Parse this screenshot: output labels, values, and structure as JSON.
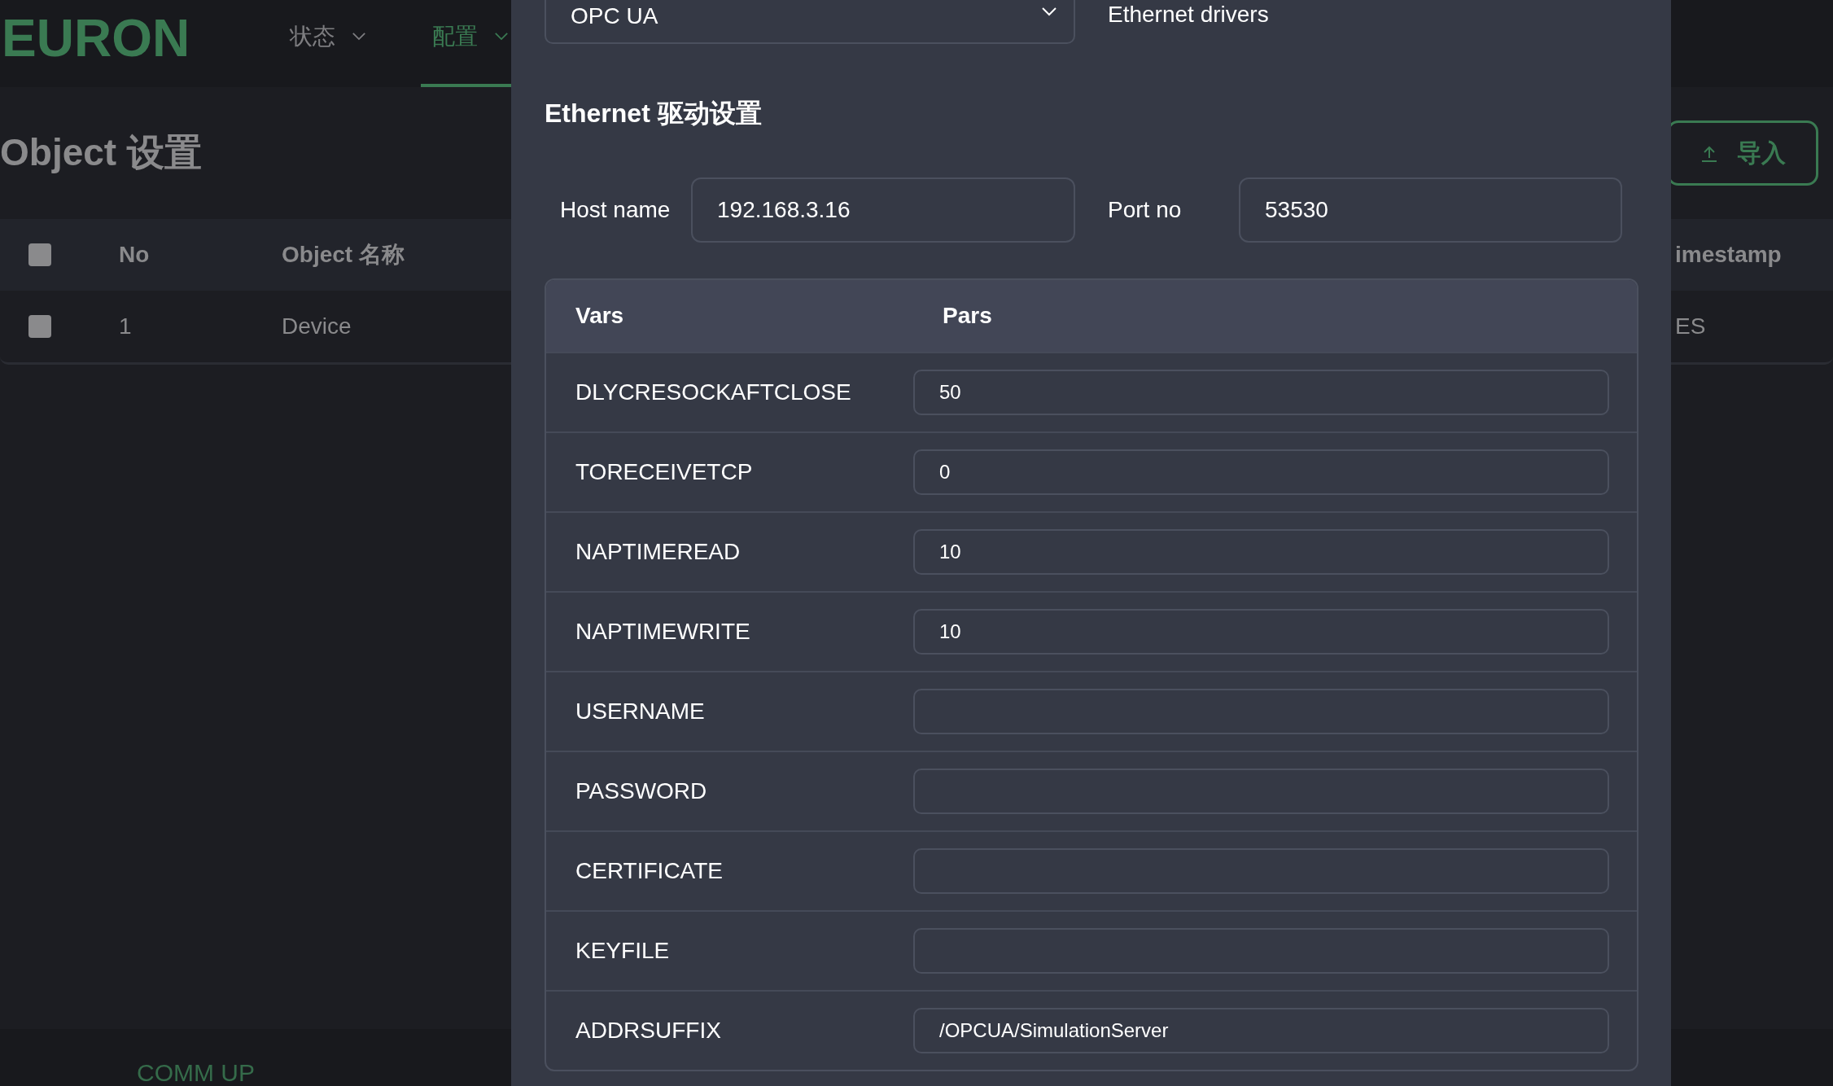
{
  "app": {
    "logo": "EURON",
    "nav": [
      {
        "label": "状态",
        "selected": false
      },
      {
        "label": "配置",
        "selected": true
      }
    ]
  },
  "page": {
    "title": "Object 设置",
    "import_button": "导入",
    "header_checked": false,
    "table": {
      "columns": [
        "No",
        "Object 名称",
        "imestamp"
      ],
      "rows": [
        {
          "checked": false,
          "cells": [
            "1",
            "Device",
            "ES"
          ]
        }
      ]
    }
  },
  "status": "COMM UP",
  "drawer": {
    "driver_select": "OPC UA",
    "driver_description": "Ethernet drivers",
    "section_title": "Ethernet 驱动设置",
    "fields": [
      {
        "label": "Host name",
        "value": "192.168.3.16"
      },
      {
        "label": "Port no",
        "value": "53530"
      }
    ],
    "params_table": {
      "columns": [
        "Vars",
        "Pars"
      ],
      "rows": [
        {
          "var": "DLYCRESOCKAFTCLOSE",
          "value": "50"
        },
        {
          "var": "TORECEIVETCP",
          "value": "0"
        },
        {
          "var": "NAPTIMEREAD",
          "value": "10"
        },
        {
          "var": "NAPTIMEWRITE",
          "value": "10"
        },
        {
          "var": "USERNAME"
        },
        {
          "var": "PASSWORD"
        },
        {
          "var": "CERTIFICATE"
        },
        {
          "var": "KEYFILE"
        },
        {
          "var": "ADDRSUFFIX",
          "value": "/OPCUA/SimulationServer"
        }
      ]
    }
  }
}
